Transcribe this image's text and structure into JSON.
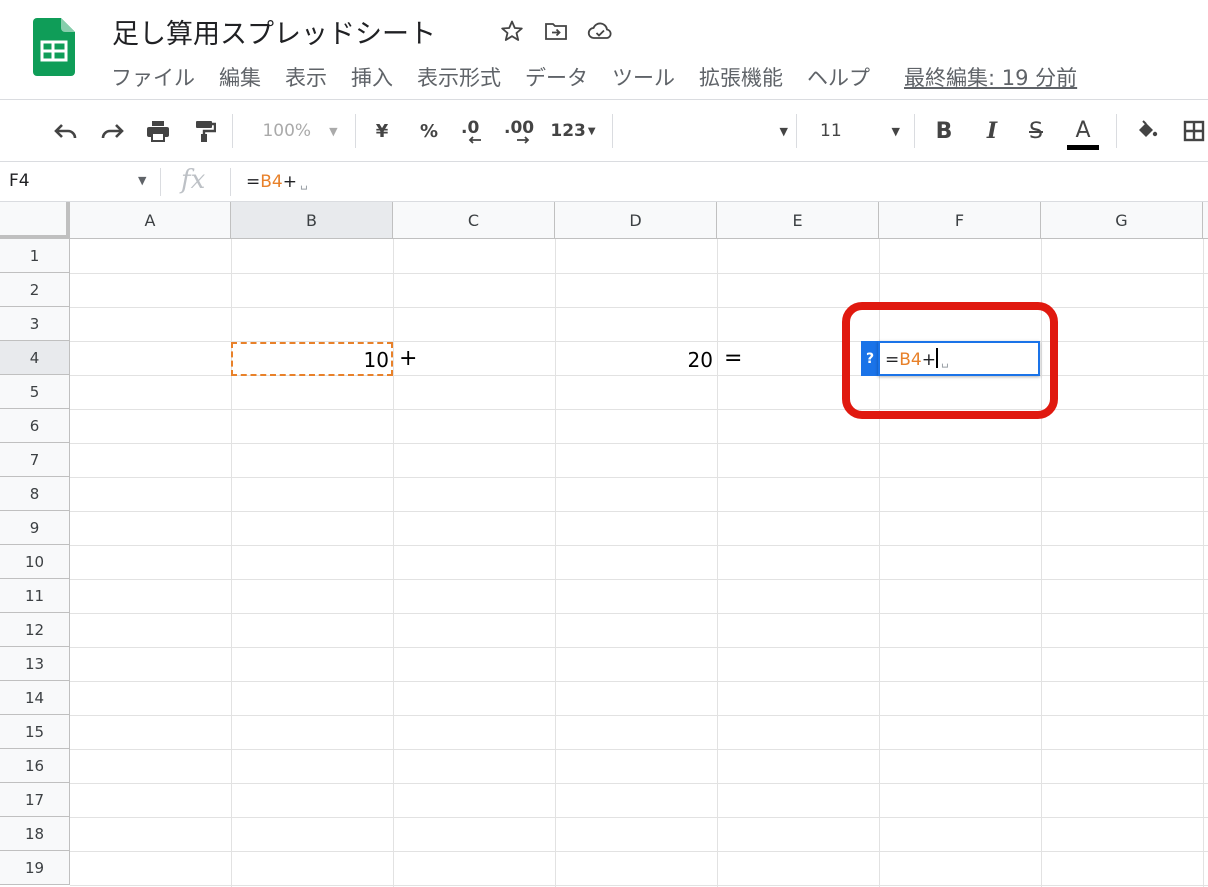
{
  "app": {
    "title": "足し算用スプレッドシート",
    "icons": [
      "star-icon",
      "move-to-folder-icon",
      "cloud-status-icon"
    ]
  },
  "menu": {
    "items": [
      "ファイル",
      "編集",
      "表示",
      "挿入",
      "表示形式",
      "データ",
      "ツール",
      "拡張機能",
      "ヘルプ"
    ],
    "last_edit": "最終編集: 19 分前"
  },
  "toolbar": {
    "zoom": "100%",
    "currency": "¥",
    "percent": "%",
    "dec_decrease": ".0",
    "dec_increase": ".00",
    "more_formats": "123",
    "font_size": "11",
    "bold": "B",
    "italic": "I",
    "strike": "S",
    "text_color": "A"
  },
  "formula_bar": {
    "name_box": "F4",
    "fx": "fx",
    "formula_prefix": "=",
    "formula_ref": "B4",
    "formula_suffix": "+",
    "space_mark": "␣"
  },
  "sheet": {
    "columns": [
      "A",
      "B",
      "C",
      "D",
      "E",
      "F",
      "G"
    ],
    "rows": [
      "1",
      "2",
      "3",
      "4",
      "5",
      "6",
      "7",
      "8",
      "9",
      "10",
      "11",
      "12",
      "13",
      "14",
      "15",
      "16",
      "17",
      "18",
      "19"
    ],
    "active_column": "F",
    "active_row": "4",
    "cells": {
      "B4": "10",
      "C4": "+",
      "D4": "20",
      "E4": "="
    },
    "editor": {
      "help_label": "?",
      "prefix": "=",
      "ref": "B4",
      "suffix": "+"
    }
  },
  "colors": {
    "reference": "#e8812a",
    "selection": "#1a73e8",
    "highlight": "#e0190f",
    "sheets_green": "#0f9d58"
  }
}
